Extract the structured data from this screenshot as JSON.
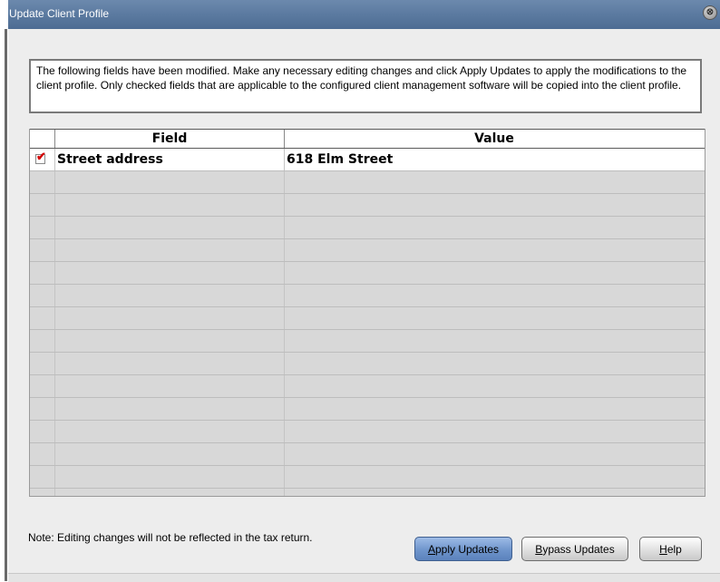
{
  "window": {
    "title": "Update Client Profile",
    "close_glyph": "⊗"
  },
  "info_text": "The following fields have been modified.  Make any necessary editing changes and click Apply Updates to apply the modifications to the client profile.  Only checked fields that are applicable to the configured client management software will be copied into the client profile.",
  "grid": {
    "columns": [
      "",
      "Field",
      "Value"
    ],
    "rows": [
      {
        "checked": true,
        "field": "Street address",
        "value": "618 Elm Street"
      }
    ]
  },
  "note": "Note: Editing changes will not be reflected in the tax return.",
  "buttons": {
    "apply": {
      "first": "A",
      "rest": "pply Updates"
    },
    "bypass": {
      "first": "B",
      "rest": "ypass Updates"
    },
    "help": {
      "first": "H",
      "rest": "elp"
    }
  },
  "colors": {
    "titlebar": "#5b7aa0",
    "check_mark": "#d40000",
    "apply_button": "#6f95cc"
  }
}
